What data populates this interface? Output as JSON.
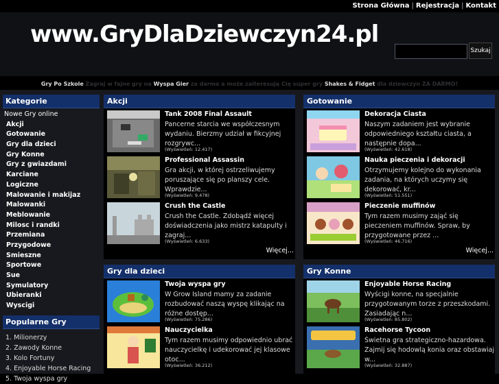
{
  "toplinks": [
    "Strona Główna",
    "Rejestracja",
    "Kontakt"
  ],
  "logo": "www.GryDlaDziewczyn24.pl",
  "search": {
    "button": "Szukaj",
    "value": ""
  },
  "tagline": {
    "link1": "Gry Po Szkole",
    "text1": " Zagraj w fajne gry na ",
    "link2": "Wyspa Gier",
    "text2": " za darmo a może zaiteresują Cię super gry ",
    "link3": "Shakes & Fidget",
    "text3": " dla dziewczyn ZA DARMO!"
  },
  "sidebar": {
    "heading": "Kategorie",
    "items": [
      "Nowe Gry online",
      "Akcji",
      "Gotowanie",
      "Gry dla dzieci",
      "Gry Konne",
      "Gry z gwiazdami",
      "Karciane",
      "Logiczne",
      "Malowanie i makijaz",
      "Malowanki",
      "Meblowanie",
      "Milosc i randki",
      "Przemiana",
      "Przygodowe",
      "Smieszne",
      "Sportowe",
      "Sue",
      "Symulatory",
      "Ubieranki",
      "Wyscigi"
    ]
  },
  "popular": {
    "heading": "Popularne Gry",
    "items": [
      "1. Milionerzy",
      "2. Zawody Konne",
      "3. Kolo Fortuny",
      "4. Enjoyable Horse Racing",
      "5. Twoja wyspa gry"
    ]
  },
  "panels": [
    {
      "heading": "Akcji",
      "more": "Więcej...",
      "items": [
        {
          "title": "Tank 2008 Final Assault",
          "desc": "Pancerne starcia we współczesnym wydaniu. Bierzmy udział w fikcyjnej rozgrywc...",
          "views": "(Wyświetleń: 12.417)"
        },
        {
          "title": "Professional Assassin",
          "desc": "Gra akcji, w której ostrzeliwujemy poruszające się po planszy cele. Wprawdzie...",
          "views": "(Wyświetleń: 9.478)"
        },
        {
          "title": "Crush the Castle",
          "desc": "Crush the Castle. Zdobądź więcej doświadczenia jako mistrz katapulty i zagraj...",
          "views": "(Wyświetleń: 6.633)"
        }
      ]
    },
    {
      "heading": "Gotowanie",
      "more": "Więcej...",
      "items": [
        {
          "title": "Dekoracja Ciasta",
          "desc": "Naszym zadaniem jest wybranie odpowiedniego kształtu ciasta, a następnie dopa...",
          "views": "(Wyświetleń: 42.618)"
        },
        {
          "title": "Nauka pieczenia i dekoracji",
          "desc": "Otrzymujemy kolejno do wykonania zadania, na których uczymy się dekorować, kr...",
          "views": "(Wyświetleń: 51.551)"
        },
        {
          "title": "Pieczenie muffinów",
          "desc": "Tym razem musimy zająć się pieczeniem muffinów. Spraw, by przygotowane przez ...",
          "views": "(Wyświetleń: 46.716)"
        }
      ]
    },
    {
      "heading": "Gry dla dzieci",
      "items": [
        {
          "title": "Twoja wyspa gry",
          "desc": "W Grow Island mamy za zadanie rozbudować naszą wyspę klikając na różne dostęp...",
          "views": "(Wyświetleń: 75.286)"
        },
        {
          "title": "Nauczycielka",
          "desc": "Tym razem musimy odpowiednio ubrać nauczycielkę i udekorować jej klasowe otoc...",
          "views": "(Wyświetleń: 36.212)"
        }
      ]
    },
    {
      "heading": "Gry Konne",
      "items": [
        {
          "title": "Enjoyable Horse Racing",
          "desc": "Wyścigi konne, na specjalnie przygotowanym torze z przeszkodami. Zasiadając n...",
          "views": "(Wyświetleń: 85.802)"
        },
        {
          "title": "Racehorse Tycoon",
          "desc": "Świetna gra strategiczno-hazardowa. Zajmij się hodowlą konia oraz obstawiaj w...",
          "views": "(Wyświetleń: 32.887)"
        }
      ]
    }
  ]
}
